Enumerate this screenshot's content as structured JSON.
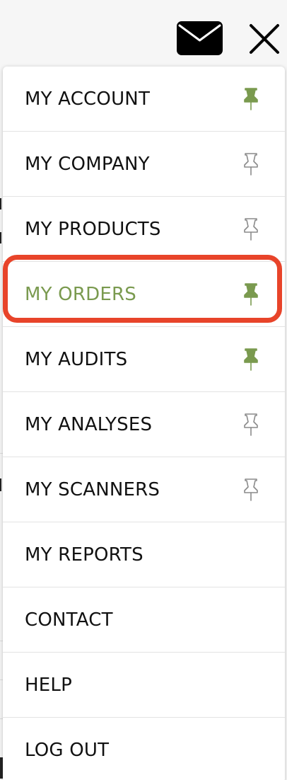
{
  "header": {
    "mail_icon": "mail-icon",
    "close_icon": "close-icon"
  },
  "colors": {
    "active": "#7a9a4f",
    "pinned": "#7a9a4f",
    "unpinned": "#8a8a8a",
    "highlight": "#e8442a"
  },
  "menu": {
    "items": [
      {
        "label": "MY ACCOUNT",
        "pin": "pinned"
      },
      {
        "label": "MY COMPANY",
        "pin": "unpinned"
      },
      {
        "label": "MY PRODUCTS",
        "pin": "unpinned"
      },
      {
        "label": "MY ORDERS",
        "pin": "pinned",
        "active": true
      },
      {
        "label": "MY AUDITS",
        "pin": "pinned"
      },
      {
        "label": "MY ANALYSES",
        "pin": "unpinned"
      },
      {
        "label": "MY SCANNERS",
        "pin": "unpinned"
      },
      {
        "label": "MY REPORTS"
      },
      {
        "label": "CONTACT"
      },
      {
        "label": "HELP"
      },
      {
        "label": "LOG OUT"
      }
    ]
  }
}
